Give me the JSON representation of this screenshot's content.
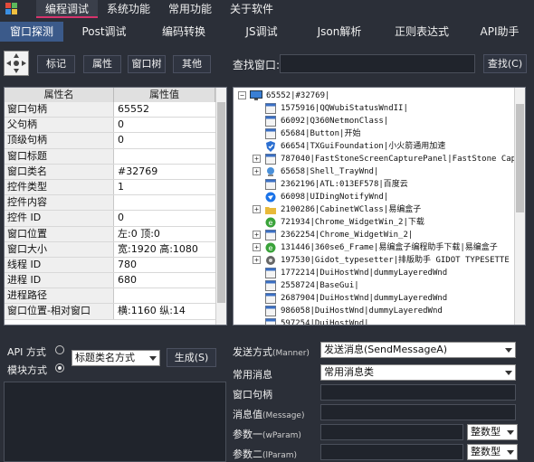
{
  "menu": [
    "编程调试",
    "系统功能",
    "常用功能",
    "关于软件"
  ],
  "tabs": [
    "窗口探测",
    "Post调试",
    "编码转换",
    "JS调试",
    "Json解析",
    "正则表达式",
    "API助手"
  ],
  "toolbar": {
    "buttons": [
      "标记",
      "属性",
      "窗口树",
      "其他"
    ],
    "search_label": "查找窗口:",
    "search_value": "",
    "search_button": "查找(C)"
  },
  "props": {
    "header_name": "属性名",
    "header_value": "属性值",
    "rows": [
      {
        "name": "窗口句柄",
        "value": "65552"
      },
      {
        "name": "父句柄",
        "value": "0"
      },
      {
        "name": "顶级句柄",
        "value": "0"
      },
      {
        "name": "窗口标题",
        "value": ""
      },
      {
        "name": "窗口类名",
        "value": "#32769"
      },
      {
        "name": "控件类型",
        "value": "1"
      },
      {
        "name": "控件内容",
        "value": ""
      },
      {
        "name": "控件 ID",
        "value": "0"
      },
      {
        "name": "窗口位置",
        "value": "左:0 顶:0"
      },
      {
        "name": "窗口大小",
        "value": "宽:1920 高:1080"
      },
      {
        "name": "线程 ID",
        "value": "780"
      },
      {
        "name": "进程 ID",
        "value": "680"
      },
      {
        "name": "进程路径",
        "value": ""
      },
      {
        "name": "窗口位置-相对窗口",
        "value": "横:1160 纵:14"
      }
    ]
  },
  "tree": {
    "root": "65552|#32769|",
    "items": [
      {
        "text": "1575916|QQWubiStatusWndII|",
        "icon": "window",
        "expander": ""
      },
      {
        "text": "66092|Q360NetmonClass|",
        "icon": "window",
        "expander": ""
      },
      {
        "text": "65684|Button|开始",
        "icon": "window",
        "expander": ""
      },
      {
        "text": "66654|TXGuiFoundation|小火箭通用加速",
        "icon": "shield",
        "expander": ""
      },
      {
        "text": "787040|FastStoneScreenCapturePanel|FastStone Cap",
        "icon": "window",
        "expander": "+"
      },
      {
        "text": "65658|Shell_TrayWnd|",
        "icon": "tray",
        "expander": "+"
      },
      {
        "text": "2362196|ATL:013EF578|百度云",
        "icon": "window",
        "expander": ""
      },
      {
        "text": "66098|UIDingNotifyWnd|",
        "icon": "ding",
        "expander": ""
      },
      {
        "text": "2100286|CabinetWClass|易编盒子",
        "icon": "folder",
        "expander": "+"
      },
      {
        "text": "721934|Chrome_WidgetWin_2|下载",
        "icon": "ie",
        "expander": ""
      },
      {
        "text": "2362254|Chrome_WidgetWin_2|",
        "icon": "window",
        "expander": "+"
      },
      {
        "text": "131446|360se6_Frame|易编盒子编程助手下载|易编盒子",
        "icon": "ie",
        "expander": "+"
      },
      {
        "text": "197530|Gidot_typesetter|排版助手  GIDOT TYPESETTE",
        "icon": "gear",
        "expander": "+"
      },
      {
        "text": "1772214|DuiHostWnd|dummyLayeredWnd",
        "icon": "window",
        "expander": ""
      },
      {
        "text": "2558724|BaseGui|",
        "icon": "window",
        "expander": ""
      },
      {
        "text": "2687904|DuiHostWnd|dummyLayeredWnd",
        "icon": "window",
        "expander": ""
      },
      {
        "text": "986058|DuiHostWnd|dummyLayeredWnd",
        "icon": "window",
        "expander": ""
      },
      {
        "text": "597254|DuiHostWnd|",
        "icon": "window",
        "expander": ""
      }
    ]
  },
  "bottom_left": {
    "api_label": "API 方式",
    "module_label": "模块方式",
    "select_value": "标题类名方式",
    "generate_button": "生成(S)"
  },
  "form": {
    "send_label": "发送方式",
    "send_hint": "(Manner)",
    "send_value": "发送消息(SendMessageA)",
    "common_label": "常用消息",
    "common_value": "常用消息类",
    "handle_label": "窗口句柄",
    "msg_label": "消息值",
    "msg_hint": "(Message)",
    "p1_label": "参数一",
    "p1_hint": "(wParam)",
    "p1_type": "整数型",
    "p2_label": "参数二",
    "p2_hint": "(lParam)",
    "p2_type": "整数型"
  },
  "colors": {
    "accent": "#d6336c",
    "tab_active": "#3b5a8a",
    "bg": "#2b2f38"
  }
}
